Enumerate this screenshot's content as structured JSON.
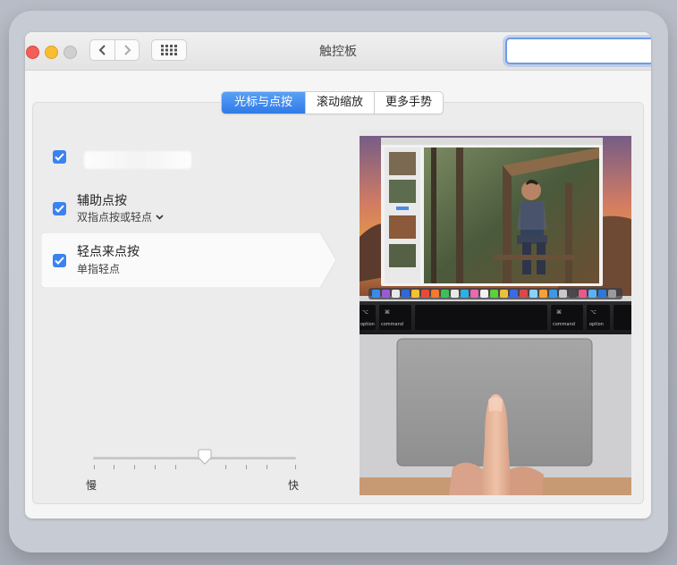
{
  "window": {
    "title": "触控板",
    "search_placeholder": ""
  },
  "tabs": [
    {
      "label": "光标与点按",
      "active": true
    },
    {
      "label": "滚动缩放",
      "active": false
    },
    {
      "label": "更多手势",
      "active": false
    }
  ],
  "options": [
    {
      "title": "",
      "subtitle": "",
      "checked": true
    },
    {
      "title": "辅助点按",
      "subtitle": "双指点按或轻点",
      "checked": true,
      "has_dropdown": true
    },
    {
      "title": "轻点来点按",
      "subtitle": "单指轻点",
      "checked": true,
      "selected": true
    }
  ],
  "slider": {
    "min_label": "慢",
    "max_label": "快",
    "value": 0.57
  },
  "preview": {
    "keys": [
      "option",
      "command",
      "command",
      "option"
    ],
    "key_symbols": [
      "⌥",
      "⌘",
      "⌘",
      "⌥"
    ]
  },
  "colors": {
    "accent": "#3b82f0",
    "close": "#f25f58",
    "minimize": "#f8bd30"
  }
}
